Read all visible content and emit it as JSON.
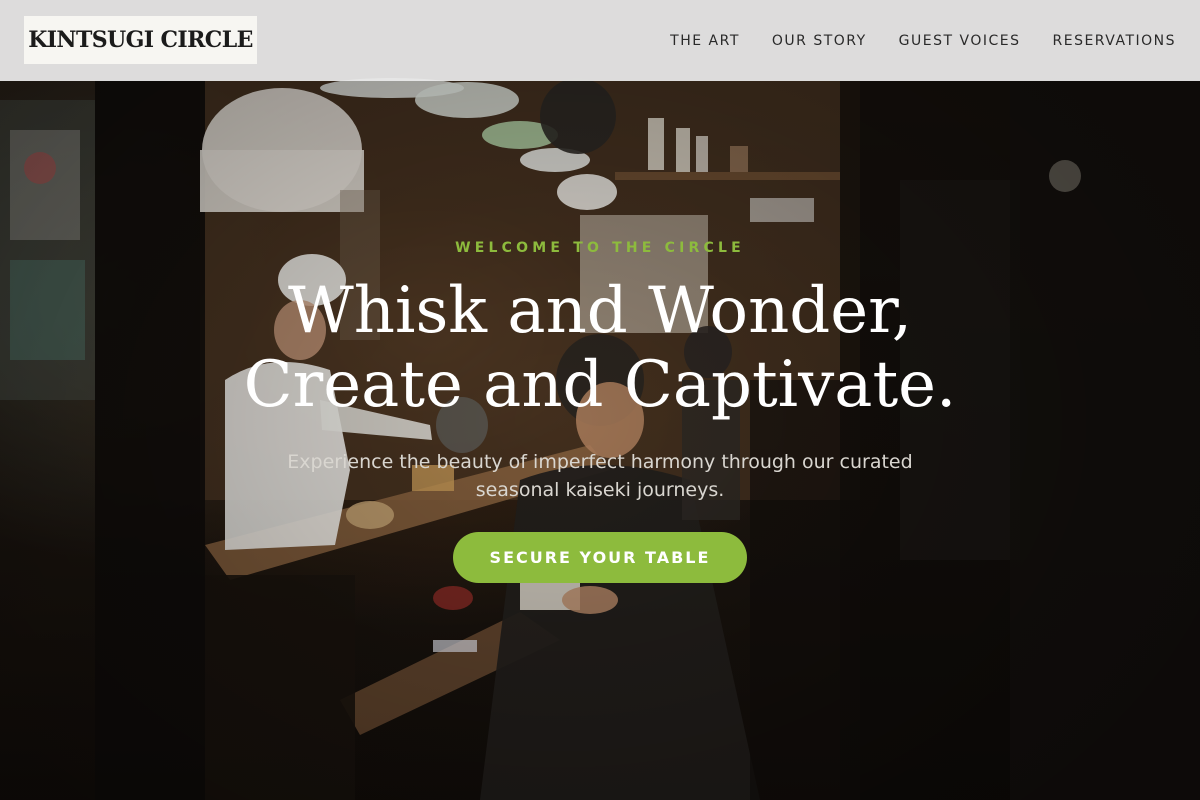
{
  "header": {
    "logo": "KINTSUGI CIRCLE",
    "nav": [
      {
        "label": "THE ART"
      },
      {
        "label": "OUR STORY"
      },
      {
        "label": "GUEST VOICES"
      },
      {
        "label": "RESERVATIONS"
      }
    ]
  },
  "hero": {
    "eyebrow": "WELCOME TO THE CIRCLE",
    "headline": "Whisk and Wonder, Create and Captivate.",
    "subtext": "Experience the beauty of imperfect harmony through our curated seasonal kaiseki journeys.",
    "cta_label": "SECURE YOUR TABLE"
  },
  "colors": {
    "accent": "#8dbb3d",
    "header_bg": "#ececec",
    "text_light": "#ffffff"
  }
}
